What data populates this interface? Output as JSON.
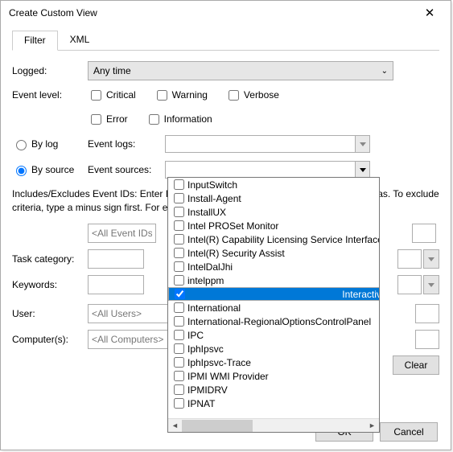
{
  "window": {
    "title": "Create Custom View"
  },
  "tabs": {
    "filter": "Filter",
    "xml": "XML"
  },
  "labels": {
    "logged": "Logged:",
    "event_level": "Event level:",
    "by_log": "By log",
    "by_source": "By source",
    "event_logs": "Event logs:",
    "event_sources": "Event sources:",
    "task_category": "Task category:",
    "keywords": "Keywords:",
    "user": "User:",
    "computers": "Computer(s):"
  },
  "logged_value": "Any time",
  "levels": {
    "critical": "Critical",
    "warning": "Warning",
    "verbose": "Verbose",
    "error": "Error",
    "information": "Information"
  },
  "note": "Includes/Excludes Event IDs: Enter ID numbers and/or ID ranges separated by commas. To exclude criteria, type a minus sign first. For example 1,3,5-99,-76",
  "placeholders": {
    "event_ids": "<All Event IDs>",
    "users": "<All Users>",
    "computers": "<All Computers>"
  },
  "clear": "Clear",
  "buttons": {
    "ok": "OK",
    "cancel": "Cancel"
  },
  "dropdown": {
    "items": [
      "InputSwitch",
      "Install-Agent",
      "InstallUX",
      "Intel PROSet Monitor",
      "Intel(R) Capability Licensing Service Interface",
      "Intel(R) Security Assist",
      "IntelDalJhi",
      "intelppm",
      "Interactive Services detection",
      "International",
      "International-RegionalOptionsControlPanel",
      "IPC",
      "IphIpsvc",
      "IphIpsvc-Trace",
      "IPMI WMI Provider",
      "IPMIDRV",
      "IPNAT"
    ],
    "selected_index": 8
  }
}
